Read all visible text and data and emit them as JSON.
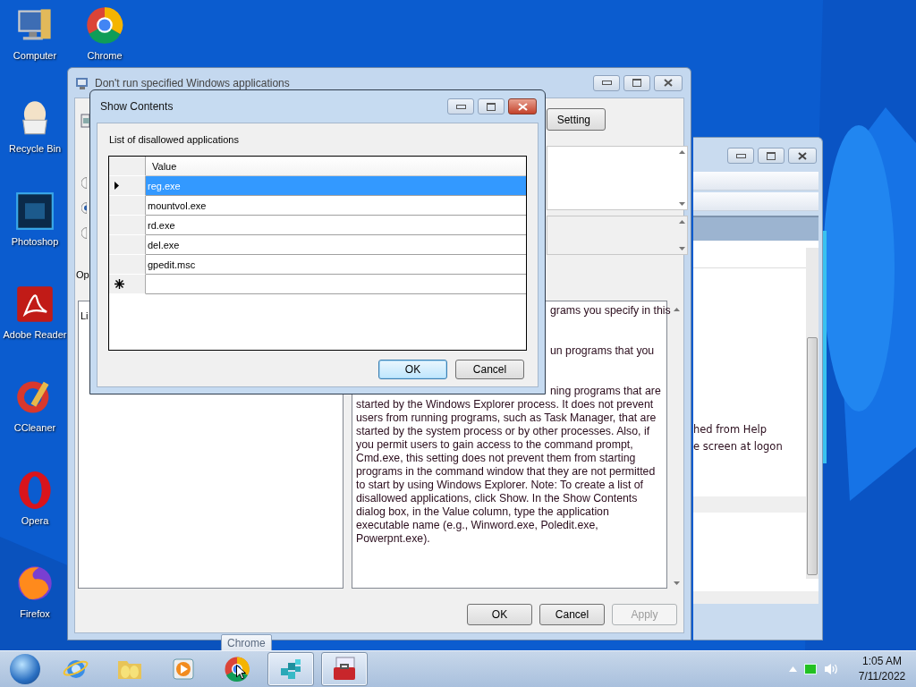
{
  "desktop_icons": [
    {
      "label": "Computer",
      "kind": "computer"
    },
    {
      "label": "Chrome",
      "kind": "wheel"
    },
    {
      "label": "Recycle Bin",
      "kind": "egg"
    },
    {
      "label": "Photoshop",
      "kind": "tile"
    },
    {
      "label": "Adobe Reader",
      "kind": "pdf"
    },
    {
      "label": "CCleaner",
      "kind": "brush"
    },
    {
      "label": "Opera",
      "kind": "ring"
    },
    {
      "label": "Firefox",
      "kind": "fox"
    }
  ],
  "background_window": {
    "lines": [
      "hed from Help",
      "e screen at logon"
    ]
  },
  "policy_dialog": {
    "title": "Don't run specified Windows applications",
    "setting_button": "Setting",
    "radios": [
      {
        "selected": false
      },
      {
        "selected": true
      },
      {
        "selected": false
      }
    ],
    "options_label": "Op",
    "options_text": "Li",
    "help_fragments": [
      "grams you specify in this",
      "un programs that you",
      "ning programs that are"
    ],
    "help_text": "started by the Windows Explorer process. It does not prevent users from running programs, such as Task Manager, that are started by the system process or by other processes. Also, if you permit users to gain access to the command prompt, Cmd.exe, this setting does not prevent them from starting programs in the command window that they are not permitted to start by using Windows Explorer. Note: To create a list of disallowed applications, click Show. In the Show Contents dialog box, in the Value column, type the application executable name (e.g., Winword.exe, Poledit.exe, Powerpnt.exe).",
    "buttons": [
      {
        "label": "OK",
        "disabled": false
      },
      {
        "label": "Cancel",
        "disabled": false
      },
      {
        "label": "Apply",
        "disabled": true
      }
    ]
  },
  "show_contents": {
    "title": "Show Contents",
    "label": "List of disallowed applications",
    "column": "Value",
    "rows": [
      {
        "value": "reg.exe",
        "selected": true
      },
      {
        "value": "mountvol.exe",
        "selected": false
      },
      {
        "value": "rd.exe",
        "selected": false
      },
      {
        "value": "del.exe",
        "selected": false
      },
      {
        "value": "gpedit.msc",
        "selected": false
      }
    ],
    "buttons": [
      {
        "label": "OK",
        "default": true
      },
      {
        "label": "Cancel",
        "default": false
      }
    ]
  },
  "tooltip": "Chrome",
  "taskbar": {
    "items": [
      {
        "kind": "start",
        "running": false
      },
      {
        "kind": "globe",
        "running": false
      },
      {
        "kind": "folder",
        "running": false
      },
      {
        "kind": "media",
        "running": false
      },
      {
        "kind": "wheel",
        "running": false
      },
      {
        "kind": "cubes",
        "running": true
      },
      {
        "kind": "toolbox",
        "running": true
      }
    ],
    "clock": {
      "time": "1:05 AM",
      "date": "7/11/2022"
    }
  }
}
